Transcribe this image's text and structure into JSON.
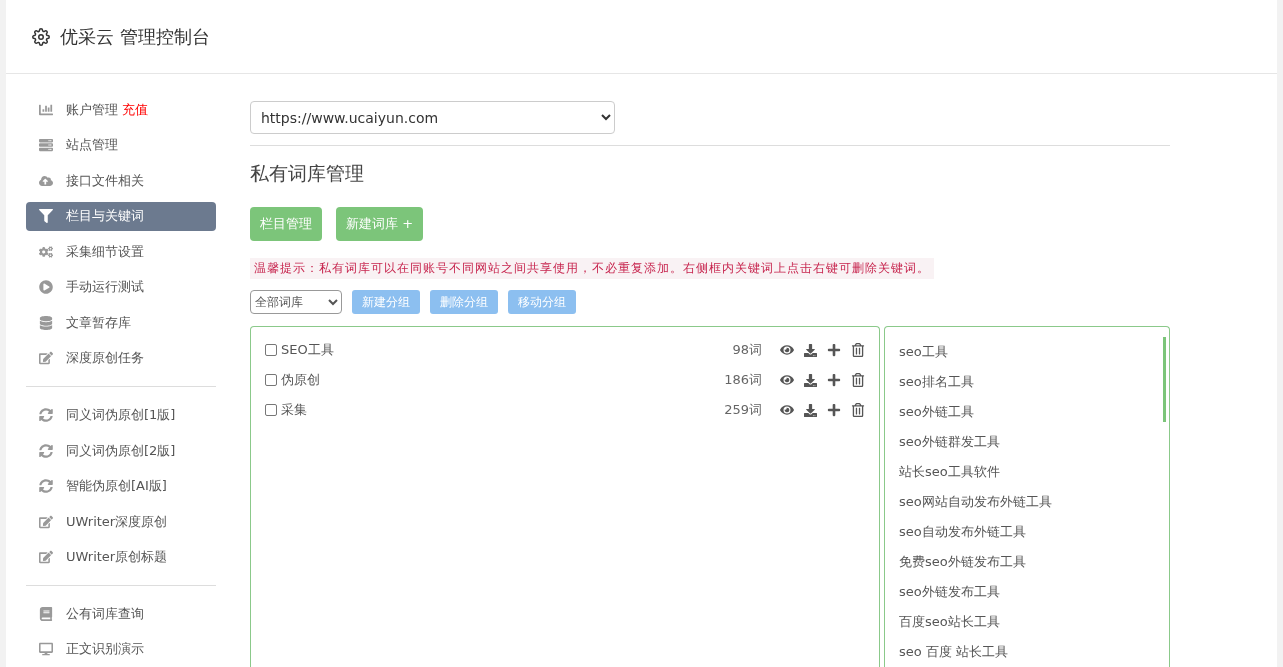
{
  "header": {
    "title": "优采云 管理控制台"
  },
  "sidebar": {
    "groups": [
      {
        "items": [
          {
            "kind": "chart",
            "label": "账户管理",
            "badge": "充值",
            "selected": false
          },
          {
            "kind": "server",
            "label": "站点管理",
            "selected": false
          },
          {
            "kind": "upload",
            "label": "接口文件相关",
            "selected": false
          },
          {
            "kind": "filter",
            "label": "栏目与关键词",
            "selected": true
          },
          {
            "kind": "gears",
            "label": "采集细节设置",
            "selected": false
          },
          {
            "kind": "play",
            "label": "手动运行测试",
            "selected": false
          },
          {
            "kind": "database",
            "label": "文章暂存库",
            "selected": false
          },
          {
            "kind": "edit",
            "label": "深度原创任务",
            "selected": false
          }
        ]
      },
      {
        "items": [
          {
            "kind": "refresh",
            "label": "同义词伪原创[1版]",
            "selected": false
          },
          {
            "kind": "refresh",
            "label": "同义词伪原创[2版]",
            "selected": false
          },
          {
            "kind": "refresh",
            "label": "智能伪原创[AI版]",
            "selected": false
          },
          {
            "kind": "edit",
            "label": "UWriter深度原创",
            "selected": false
          },
          {
            "kind": "edit",
            "label": "UWriter原创标题",
            "selected": false
          }
        ]
      },
      {
        "items": [
          {
            "kind": "book",
            "label": "公有词库查询",
            "selected": false
          },
          {
            "kind": "monitor",
            "label": "正文识别演示",
            "selected": false
          }
        ]
      }
    ]
  },
  "site_select": {
    "value": "https://www.ucaiyun.com"
  },
  "section_title": "私有词库管理",
  "action_buttons": [
    "栏目管理",
    "新建词库 +"
  ],
  "tip": "温馨提示：私有词库可以在同账号不同网站之间共享使用，不必重复添加。右侧框内关键词上点击右键可删除关键词。",
  "group_select": {
    "value": "全部词库"
  },
  "group_buttons": [
    "新建分组",
    "删除分组",
    "移动分组"
  ],
  "libraries": [
    {
      "name": "SEO工具",
      "count": "98词",
      "checked": false
    },
    {
      "name": "伪原创",
      "count": "186词",
      "checked": false
    },
    {
      "name": "采集",
      "count": "259词",
      "checked": false
    }
  ],
  "keywords": [
    "seo工具",
    "seo排名工具",
    "seo外链工具",
    "seo外链群发工具",
    "站长seo工具软件",
    "seo网站自动发布外链工具",
    "seo自动发布外链工具",
    "免费seo外链发布工具",
    "seo外链发布工具",
    "百度seo站长工具",
    "seo 百度 站长工具"
  ]
}
